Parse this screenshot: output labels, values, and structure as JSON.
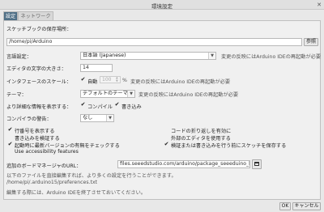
{
  "window": {
    "title": "環境設定",
    "close_icon": "close-icon"
  },
  "tabs": [
    {
      "label": "設定",
      "active": true
    },
    {
      "label": "ネットワーク",
      "active": false
    }
  ],
  "sketchbook": {
    "label": "スケッチブックの保存場所：",
    "path": "/home/pi/Arduino",
    "browse_label": "参照"
  },
  "language": {
    "label": "言語設定：",
    "value": "日本語 (Japanese)",
    "note": "変更の反映にはArduino IDEの再起動が必要"
  },
  "font_size": {
    "label": "エディタの文字の大きさ：",
    "value": "14"
  },
  "interface_scale": {
    "label": "インタフェースのスケール：",
    "auto_label": "自動",
    "auto_checked": true,
    "percent_value": "100",
    "percent_unit": "%",
    "note": "変更の反映にはArduino IDEの再起動が必要"
  },
  "theme": {
    "label": "テーマ：",
    "value": "デフォルトのテーマ",
    "note": "変更の反映にはArduino IDEの再起動が必要"
  },
  "verbose": {
    "label": "より詳細な情報を表示する：",
    "compile_label": "コンパイル",
    "compile_checked": true,
    "upload_label": "書き込み",
    "upload_checked": true
  },
  "compiler_warnings": {
    "label": "コンパイラの警告：",
    "value": "なし"
  },
  "options": [
    {
      "label": "行番号を表示する",
      "checked": true
    },
    {
      "label": "コードの折り返しを有効に",
      "checked": false
    },
    {
      "label": "書き込みを検証する",
      "checked": false
    },
    {
      "label": "外部のエディタを使用する",
      "checked": false
    },
    {
      "label": "起動時に最新バージョンの有無をチェックする",
      "checked": true
    },
    {
      "label": "検証または書き込みを行う前にスケッチを保存する",
      "checked": true
    },
    {
      "label": "Use accessibility features",
      "checked": false
    }
  ],
  "board_manager": {
    "label": "追加のボードマネージャのURL：",
    "value": "files.seeedstudio.com/arduino/package_seeeduino_boards_index.json",
    "window_icon": "window-icon"
  },
  "info_text": "以下のファイルを直接編集すれば、より多くの設定を行うことができます。",
  "prefs_path": "/home/pi/.arduino15/preferences.txt",
  "edit_note": "編集する際には、Arduino IDEを終了させておいてください。",
  "buttons": {
    "ok": "OK",
    "cancel": "キャンセル"
  }
}
